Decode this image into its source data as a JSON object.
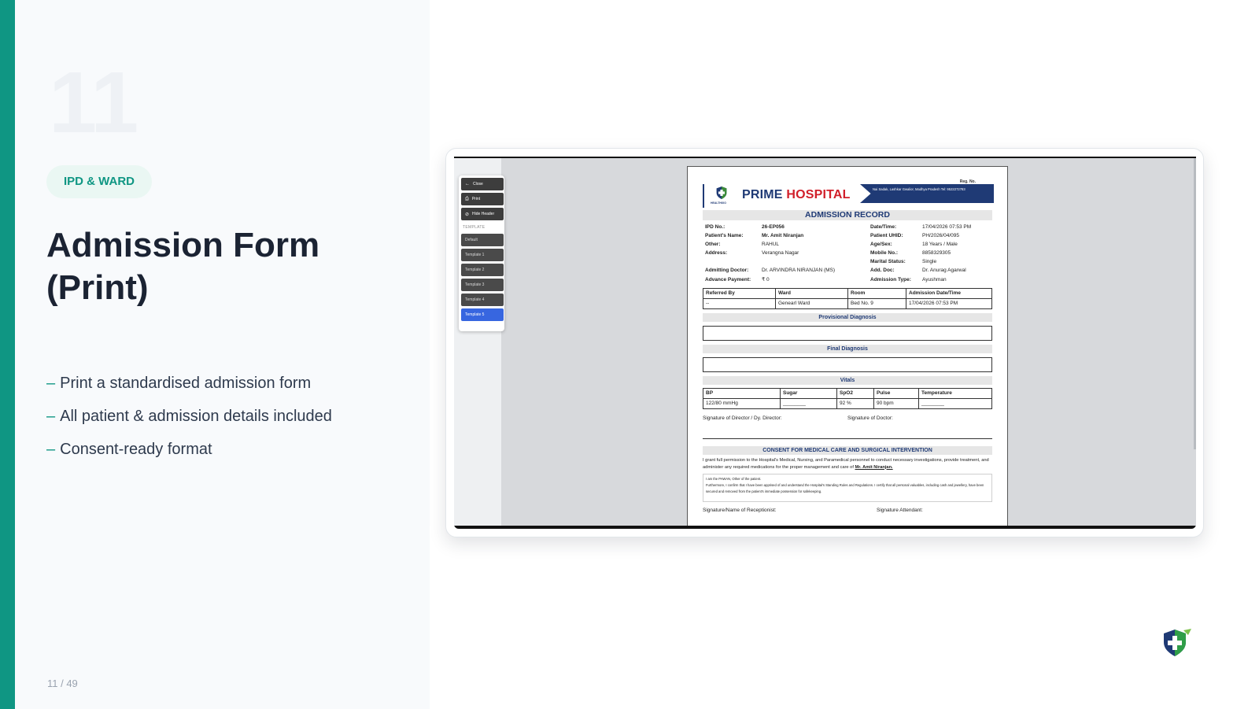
{
  "slide": {
    "number": "11",
    "category": "IPD & WARD",
    "title_line1": "Admission Form",
    "title_line2": "(Print)",
    "bullets": [
      "Print a standardised admission form",
      "All patient & admission details included",
      "Consent-ready format"
    ],
    "bullet_dash": "–",
    "page_counter": "11 / 49",
    "accent_color": "#0f9683"
  },
  "toolbar": {
    "close_label": "Close",
    "print_label": "Print",
    "hide_header_label": "Hide Header",
    "template_heading": "TEMPLATE",
    "templates": [
      "Default",
      "Template 1",
      "Template 2",
      "Template 3",
      "Template 4",
      "Template 5"
    ],
    "active_template": "Template 5"
  },
  "document": {
    "reg_no_label": "Reg. No.",
    "hospital_name_part1": "PRIME",
    "hospital_name_part2": "HOSPITAL",
    "logo_subtext": "HEALTHIXO",
    "address": "Nai Sadak, Lashkar Gwalior, Madhya Pradesh Tel: 9522272783",
    "heading": "ADMISSION RECORD",
    "fields": {
      "ipd_no_label": "IPD No.:",
      "ipd_no": "26-EP056",
      "datetime_label": "Date/Time:",
      "datetime": "17/04/2026 07:53 PM",
      "patient_name_label": "Patient's Name:",
      "patient_name": "Mr. Amit Niranjan",
      "uhid_label": "Patient UHID:",
      "uhid": "PH/2026/04/095",
      "other_label": "Other:",
      "other": "RAHUL",
      "age_sex_label": "Age/Sex:",
      "age_sex": "18 Years / Male",
      "address_label": "Address:",
      "address": "Verangna Nagar",
      "mobile_label": "Mobile No.:",
      "mobile": "8858329305",
      "marital_label": "Marital Status:",
      "marital": "Single",
      "admitting_doctor_label": "Admitting Doctor:",
      "admitting_doctor": "Dr. ARVINDRA NIRANJAN (MS)",
      "add_doc_label": "Add. Doc:",
      "add_doc": "Dr. Anurag Agarwal",
      "advance_label": "Advance Payment:",
      "advance": "₹ 0",
      "admission_type_label": "Admission Type:",
      "admission_type": "Ayushman"
    },
    "admission_table": {
      "headers": [
        "Referred By",
        "Ward",
        "Room",
        "Admission Date/Time"
      ],
      "row": [
        "--",
        "Genearl Ward",
        "Bed No. 9",
        "17/04/2026 07:53 PM"
      ]
    },
    "provisional_diagnosis": "Provisional Diagnosis",
    "final_diagnosis": "Final Diagnosis",
    "vitals_title": "Vitals",
    "vitals_table": {
      "headers": [
        "BP",
        "Sugar",
        "SpO2",
        "Pulse",
        "Temperature"
      ],
      "row": [
        "122/80 mmHg",
        "________",
        "92 %",
        "90 bpm",
        "________"
      ]
    },
    "sig_director": "Signature of Director / Dy. Director:",
    "sig_doctor": "Signature of Doctor:",
    "consent_title": "CONSENT FOR MEDICAL CARE AND SURGICAL INTERVENTION",
    "consent_text": "I grant full permission to the Hospital's Medical, Nursing, and Paramedical personnel to conduct necessary investigations, provide treatment, and administer any required medications for the proper management and care of",
    "consent_patient": "Mr. Amit Niranjan.",
    "consent_box_line1": "I am the PAWAN, Other of the patient.",
    "consent_box_line2": "Furthermore, I confirm that I have been apprised of and understand the Hospital's Standing Rules and Regulations. I certify that all personal valuables, including cash and jewellery, have been secured and removed from the patient's immediate possession for safekeeping.",
    "sig_receptionist": "Signature/Name of Receptionist:",
    "sig_attendant": "Signature Attendant:"
  },
  "icons": {
    "close": "arrow-left-icon",
    "print": "printer-icon",
    "hide_header": "eye-off-icon",
    "brand": "shield-cross-logo-icon"
  }
}
